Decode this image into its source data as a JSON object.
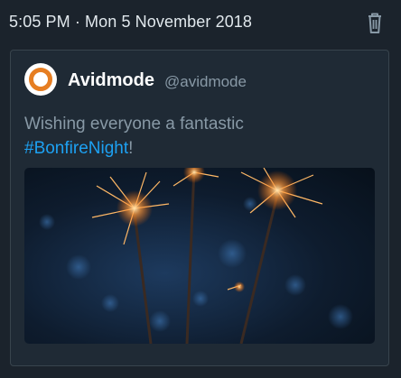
{
  "header": {
    "timestamp": "5:05 PM · Mon 5 November 2018"
  },
  "icons": {
    "delete": "trash-icon",
    "avatar": "avidmode-logo"
  },
  "tweet": {
    "author_name": "Avidmode",
    "author_handle": "@avidmode",
    "text_prefix": "Wishing everyone a fantastic",
    "hashtag": "#BonfireNight",
    "text_suffix": "!"
  },
  "colors": {
    "background": "#1b232c",
    "card": "#1f2a35",
    "hashtag": "#1da1f2",
    "brand": "#e67e22"
  }
}
